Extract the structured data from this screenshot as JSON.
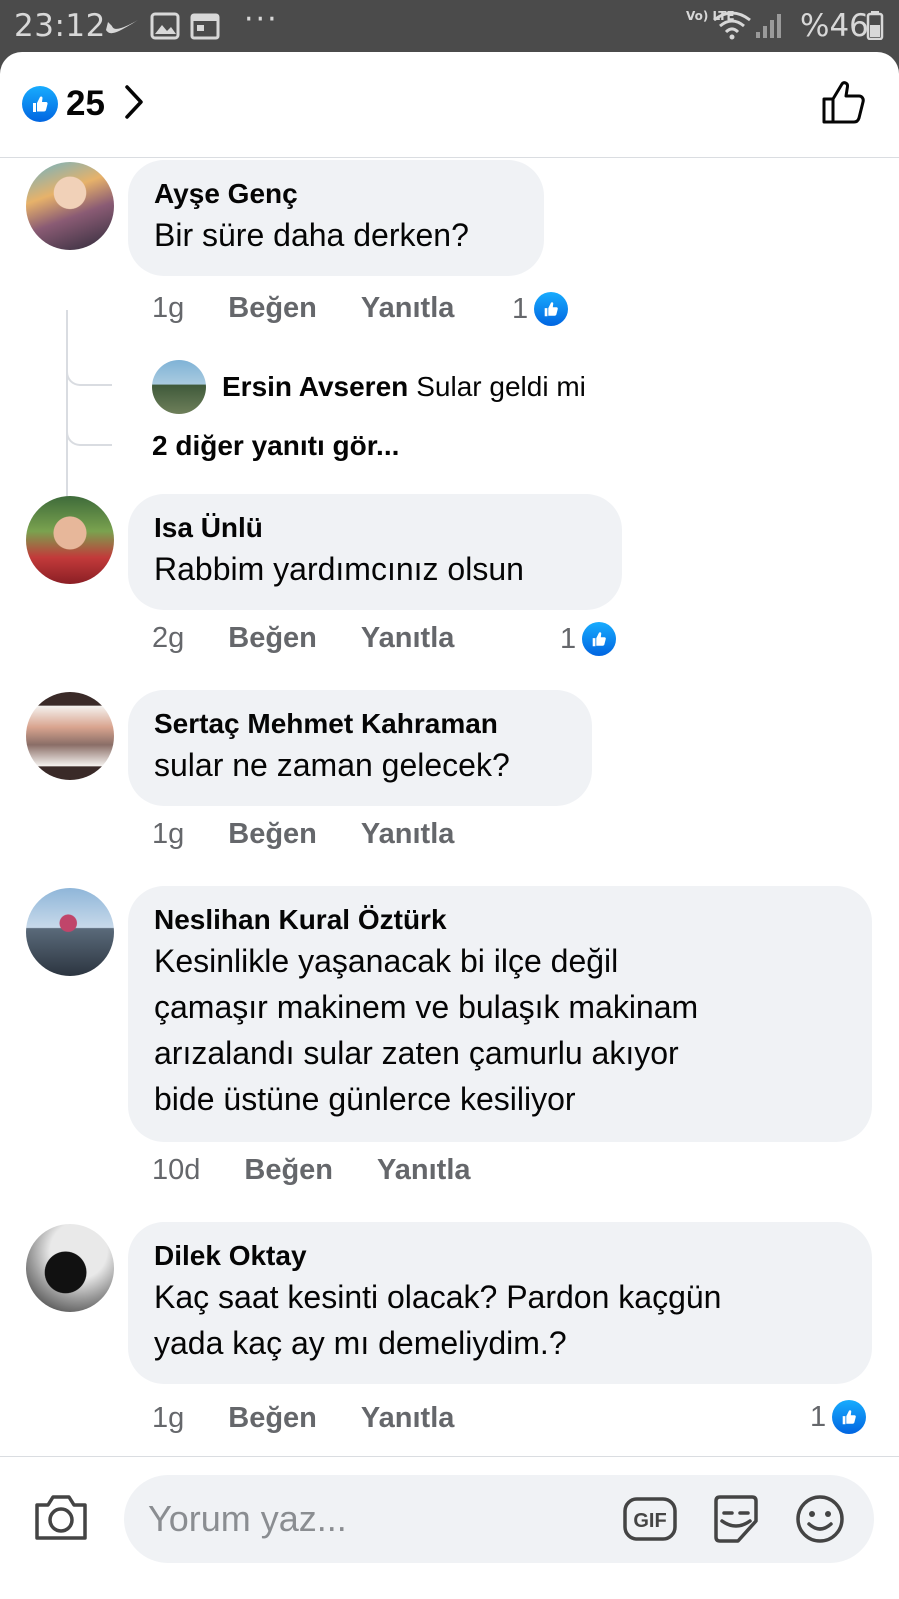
{
  "status_bar": {
    "time": "23:12",
    "network": "Vo) LTE",
    "battery": "%46",
    "icons": [
      "nike-icon",
      "image-icon",
      "calendar-icon",
      "more-dots-icon",
      "wifi-icon",
      "signal-icon",
      "battery-icon"
    ]
  },
  "header": {
    "reaction_count": "25",
    "icons": [
      "like-reaction-icon",
      "chevron-right-icon",
      "thumbs-up-outline-icon"
    ]
  },
  "comments": [
    {
      "author": "Ayşe Genç",
      "text": "Bir süre daha derken?",
      "age": "1g",
      "like_label": "Beğen",
      "reply_label": "Yanıtla",
      "reactions": "1",
      "reply_preview": {
        "author": "Ersin Avseren",
        "text": "Sular geldi mi"
      },
      "more_replies": "2 diğer yanıtı gör..."
    },
    {
      "author": "Isa Ünlü",
      "text": "Rabbim yardımcınız  olsun",
      "age": "2g",
      "like_label": "Beğen",
      "reply_label": "Yanıtla",
      "reactions": "1"
    },
    {
      "author": "Sertaç Mehmet Kahraman",
      "text": "sular ne zaman gelecek?",
      "age": "1g",
      "like_label": "Beğen",
      "reply_label": "Yanıtla"
    },
    {
      "author": "Neslihan Kural Öztürk",
      "text_lines": [
        "Kesinlikle yaşanacak bi ilçe değil",
        "çamaşır makinem ve bulaşık makinam",
        "arızalandı  sular zaten çamurlu akıyor",
        "bide üstüne günlerce kesiliyor"
      ],
      "age": "10d",
      "like_label": "Beğen",
      "reply_label": "Yanıtla"
    },
    {
      "author": "Dilek Oktay",
      "text_lines": [
        "Kaç saat kesinti olacak? Pardon kaçgün",
        "yada kaç ay mı demeliydim.?"
      ],
      "age": "1g",
      "like_label": "Beğen",
      "reply_label": "Yanıtla",
      "reactions": "1"
    }
  ],
  "composer": {
    "placeholder": "Yorum yaz...",
    "gif_label": "GIF",
    "icons": [
      "camera-icon",
      "gif-icon",
      "sticker-icon",
      "emoji-icon"
    ]
  },
  "colors": {
    "status_bar": "#4b4b4b",
    "bubble": "#f0f2f5",
    "meta_text": "#65676b",
    "like_blue": "#1877f2"
  }
}
